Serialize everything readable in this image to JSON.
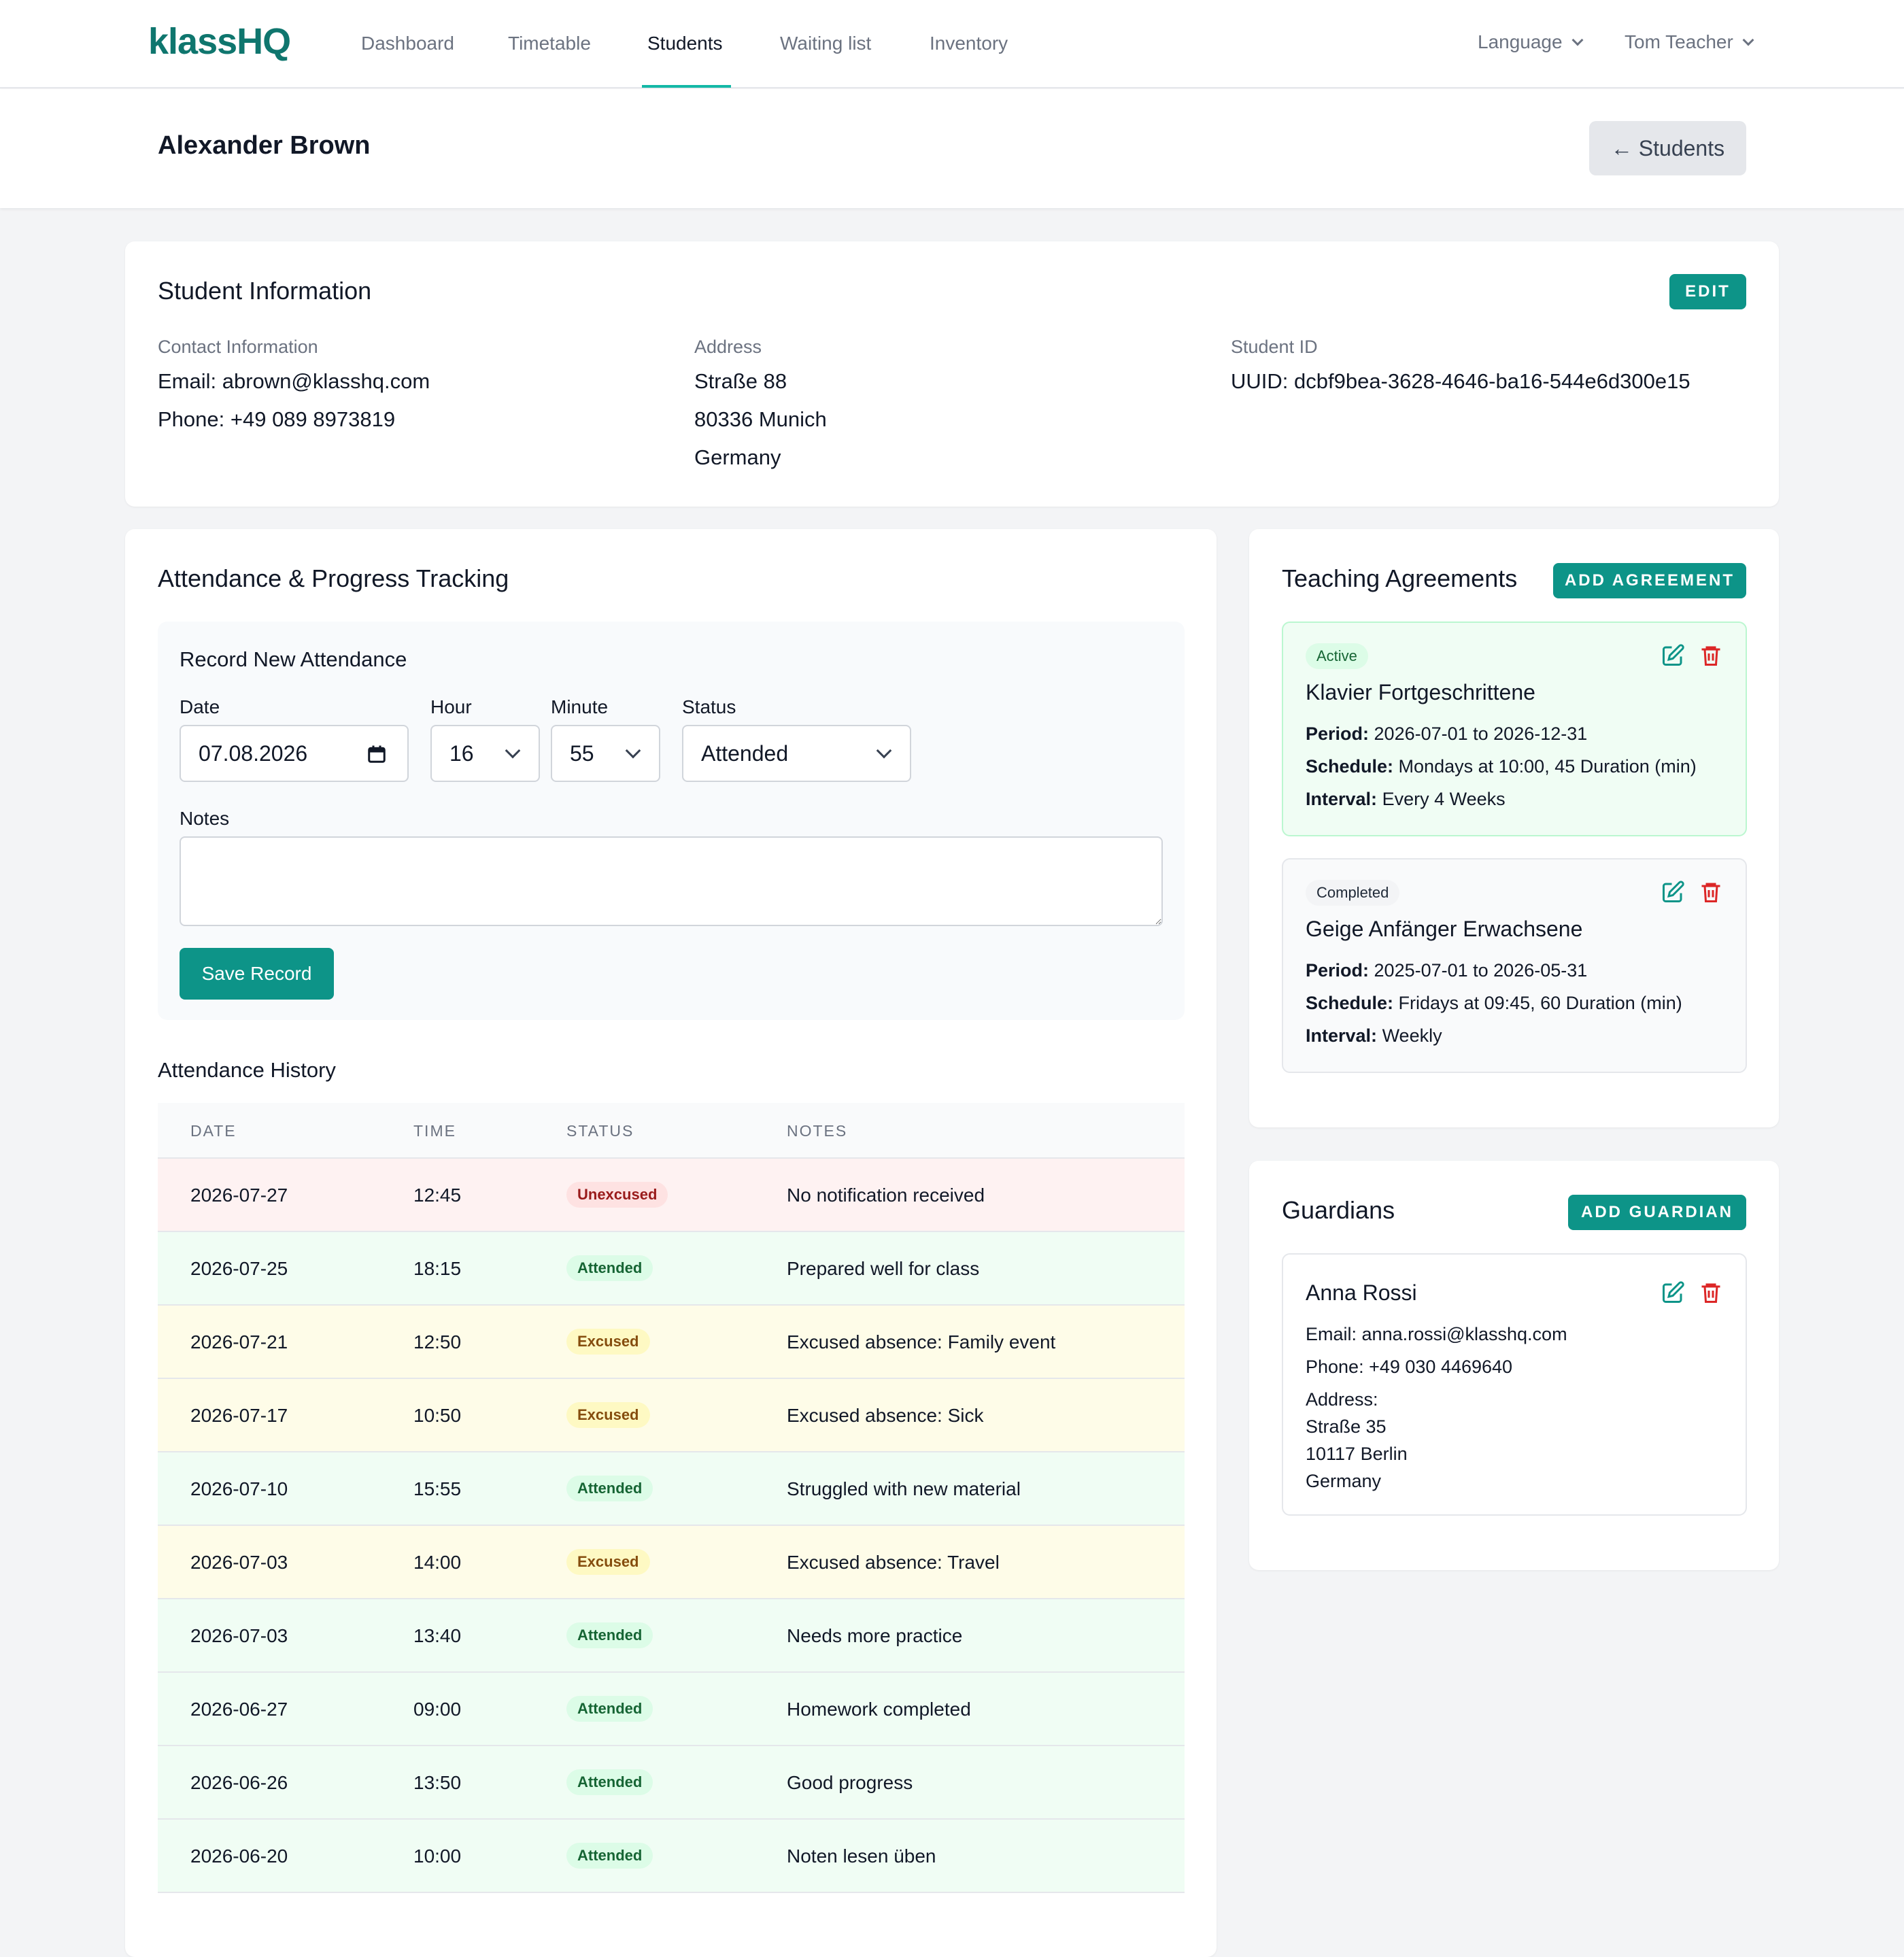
{
  "nav": {
    "logo": "klassHQ",
    "links": [
      "Dashboard",
      "Timetable",
      "Students",
      "Waiting list",
      "Inventory"
    ],
    "active_index": 2,
    "language": "Language",
    "user": "Tom Teacher"
  },
  "header": {
    "title": "Alexander Brown",
    "back_label": "← Students"
  },
  "student_info": {
    "title": "Student Information",
    "edit_label": "EDIT",
    "contact_label": "Contact Information",
    "email": "Email: abrown@klasshq.com",
    "phone": "Phone: +49 089 8973819",
    "address_label": "Address",
    "street": "Straße 88",
    "city": "80336 Munich",
    "country": "Germany",
    "id_label": "Student ID",
    "uuid": "UUID: dcbf9bea-3628-4646-ba16-544e6d300e15"
  },
  "attendance": {
    "title": "Attendance & Progress Tracking",
    "form": {
      "title": "Record New Attendance",
      "date_label": "Date",
      "date_value": "07.08.2026",
      "hour_label": "Hour",
      "hour_value": "16",
      "minute_label": "Minute",
      "minute_value": "55",
      "status_label": "Status",
      "status_value": "Attended",
      "notes_label": "Notes",
      "notes_value": "",
      "save_label": "Save Record"
    },
    "history_title": "Attendance History",
    "columns": [
      "DATE",
      "TIME",
      "STATUS",
      "NOTES"
    ],
    "rows": [
      {
        "date": "2026-07-27",
        "time": "12:45",
        "status": "Unexcused",
        "notes": "No notification received"
      },
      {
        "date": "2026-07-25",
        "time": "18:15",
        "status": "Attended",
        "notes": "Prepared well for class"
      },
      {
        "date": "2026-07-21",
        "time": "12:50",
        "status": "Excused",
        "notes": "Excused absence: Family event"
      },
      {
        "date": "2026-07-17",
        "time": "10:50",
        "status": "Excused",
        "notes": "Excused absence: Sick"
      },
      {
        "date": "2026-07-10",
        "time": "15:55",
        "status": "Attended",
        "notes": "Struggled with new material"
      },
      {
        "date": "2026-07-03",
        "time": "14:00",
        "status": "Excused",
        "notes": "Excused absence: Travel"
      },
      {
        "date": "2026-07-03",
        "time": "13:40",
        "status": "Attended",
        "notes": "Needs more practice"
      },
      {
        "date": "2026-06-27",
        "time": "09:00",
        "status": "Attended",
        "notes": "Homework completed"
      },
      {
        "date": "2026-06-26",
        "time": "13:50",
        "status": "Attended",
        "notes": "Good progress"
      },
      {
        "date": "2026-06-20",
        "time": "10:00",
        "status": "Attended",
        "notes": "Noten lesen üben"
      }
    ]
  },
  "agreements": {
    "title": "Teaching Agreements",
    "add_label": "ADD AGREEMENT",
    "items": [
      {
        "status": "Active",
        "title": "Klavier Fortgeschrittene",
        "period_label": "Period:",
        "period": "2026-07-01 to 2026-12-31",
        "schedule_label": "Schedule:",
        "schedule": "Mondays at 10:00, 45 Duration (min)",
        "interval_label": "Interval:",
        "interval": "Every 4 Weeks"
      },
      {
        "status": "Completed",
        "title": "Geige Anfänger Erwachsene",
        "period_label": "Period:",
        "period": "2025-07-01 to 2026-05-31",
        "schedule_label": "Schedule:",
        "schedule": "Fridays at 09:45, 60 Duration (min)",
        "interval_label": "Interval:",
        "interval": "Weekly"
      }
    ]
  },
  "guardians": {
    "title": "Guardians",
    "add_label": "ADD GUARDIAN",
    "items": [
      {
        "name": "Anna Rossi",
        "email_label": "Email:",
        "email": "anna.rossi@klasshq.com",
        "phone_label": "Phone:",
        "phone": "+49 030 4469640",
        "address_label": "Address:",
        "street": "Straße 35",
        "city": "10117 Berlin",
        "country": "Germany"
      }
    ]
  },
  "colors": {
    "brand": "#0f766e",
    "accent": "#0d9488",
    "unexcused_row": "#fef2f2",
    "attended_row": "#f0fdf4",
    "excused_row": "#fefce8",
    "delete_icon": "#dc2626"
  }
}
